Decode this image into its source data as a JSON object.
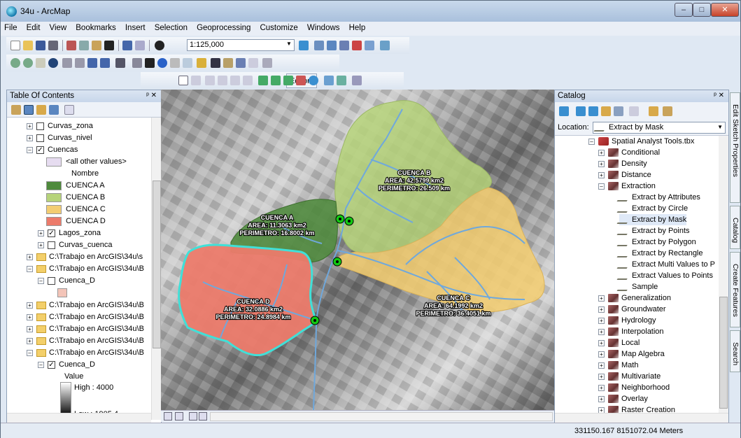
{
  "window": {
    "title": "34u - ArcMap",
    "min": "–",
    "max": "□",
    "close": "✕"
  },
  "menu": [
    "File",
    "Edit",
    "View",
    "Bookmarks",
    "Insert",
    "Selection",
    "Geoprocessing",
    "Customize",
    "Windows",
    "Help"
  ],
  "toolbar": {
    "scale": "1:125,000",
    "editor": "Editor▾"
  },
  "toc": {
    "title": "Table Of Contents",
    "pin": "ᵖ ✕",
    "items": [
      {
        "label": "Curvas_zona"
      },
      {
        "label": "Curvas_nivel"
      },
      {
        "label": "Cuencas"
      },
      {
        "label": "<all other values>"
      },
      {
        "label": "Nombre"
      },
      {
        "label": "CUENCA A"
      },
      {
        "label": "CUENCA B"
      },
      {
        "label": "CUENCA C"
      },
      {
        "label": "CUENCA D"
      },
      {
        "label": "Lagos_zona"
      },
      {
        "label": "Curvas_cuenca"
      },
      {
        "label": "C:\\Trabajo en ArcGIS\\34u\\s"
      },
      {
        "label": "C:\\Trabajo en ArcGIS\\34u\\B"
      },
      {
        "label": "Cuenca_D"
      },
      {
        "label": ""
      },
      {
        "label": "C:\\Trabajo en ArcGIS\\34u\\B"
      },
      {
        "label": "C:\\Trabajo en ArcGIS\\34u\\B"
      },
      {
        "label": "C:\\Trabajo en ArcGIS\\34u\\B"
      },
      {
        "label": "C:\\Trabajo en ArcGIS\\34u\\B"
      },
      {
        "label": "C:\\Trabajo en ArcGIS\\34u\\B"
      },
      {
        "label": "Cuenca_D"
      },
      {
        "label": "Value"
      },
      {
        "label": "High : 4000"
      },
      {
        "label": "Low : 1905.4"
      }
    ],
    "colors": {
      "all_other": "#e6dcf0",
      "a": "#4e8a3c",
      "b": "#b6d37a",
      "c": "#f3cd72",
      "d": "#ec7b6b",
      "cuenca_d": "#f3c4b8"
    }
  },
  "map": {
    "cuenca_a": {
      "name": "CUENCA A",
      "area": "AREA: 11.3063 km2",
      "perim": "PERIMETRO: 16.8002 km"
    },
    "cuenca_b": {
      "name": "CUENCA B",
      "area": "AREA: 42.5799 km2",
      "perim": "PERIMETRO: 26.509 km"
    },
    "cuenca_c": {
      "name": "CUENCA C",
      "area": "AREA: 64.1992 km2",
      "perim": "PERIMETRO: 36.4051 km"
    },
    "cuenca_d": {
      "name": "CUENCA D",
      "area": "AREA: 32.0886 km2",
      "perim": "PERIMETRO: 24.8984 km"
    }
  },
  "catalog": {
    "title": "Catalog",
    "pin": "ᵖ ✕",
    "location_label": "Location:",
    "location_value": "Extract by Mask",
    "tree": [
      {
        "label": "Spatial Analyst Tools.tbx"
      },
      {
        "label": "Conditional"
      },
      {
        "label": "Density"
      },
      {
        "label": "Distance"
      },
      {
        "label": "Extraction"
      },
      {
        "label": "Extract by Attributes"
      },
      {
        "label": "Extract by Circle"
      },
      {
        "label": "Extract by Mask"
      },
      {
        "label": "Extract by Points"
      },
      {
        "label": "Extract by Polygon"
      },
      {
        "label": "Extract by Rectangle"
      },
      {
        "label": "Extract Multi Values to P"
      },
      {
        "label": "Extract Values to Points"
      },
      {
        "label": "Sample"
      },
      {
        "label": "Generalization"
      },
      {
        "label": "Groundwater"
      },
      {
        "label": "Hydrology"
      },
      {
        "label": "Interpolation"
      },
      {
        "label": "Local"
      },
      {
        "label": "Map Algebra"
      },
      {
        "label": "Math"
      },
      {
        "label": "Multivariate"
      },
      {
        "label": "Neighborhood"
      },
      {
        "label": "Overlay"
      },
      {
        "label": "Raster Creation"
      }
    ]
  },
  "sidetabs": [
    "Edit Sketch Properties",
    "Catalog",
    "Create Features",
    "Search"
  ],
  "status": {
    "coords": "331150.167  8151072.04 Meters"
  }
}
